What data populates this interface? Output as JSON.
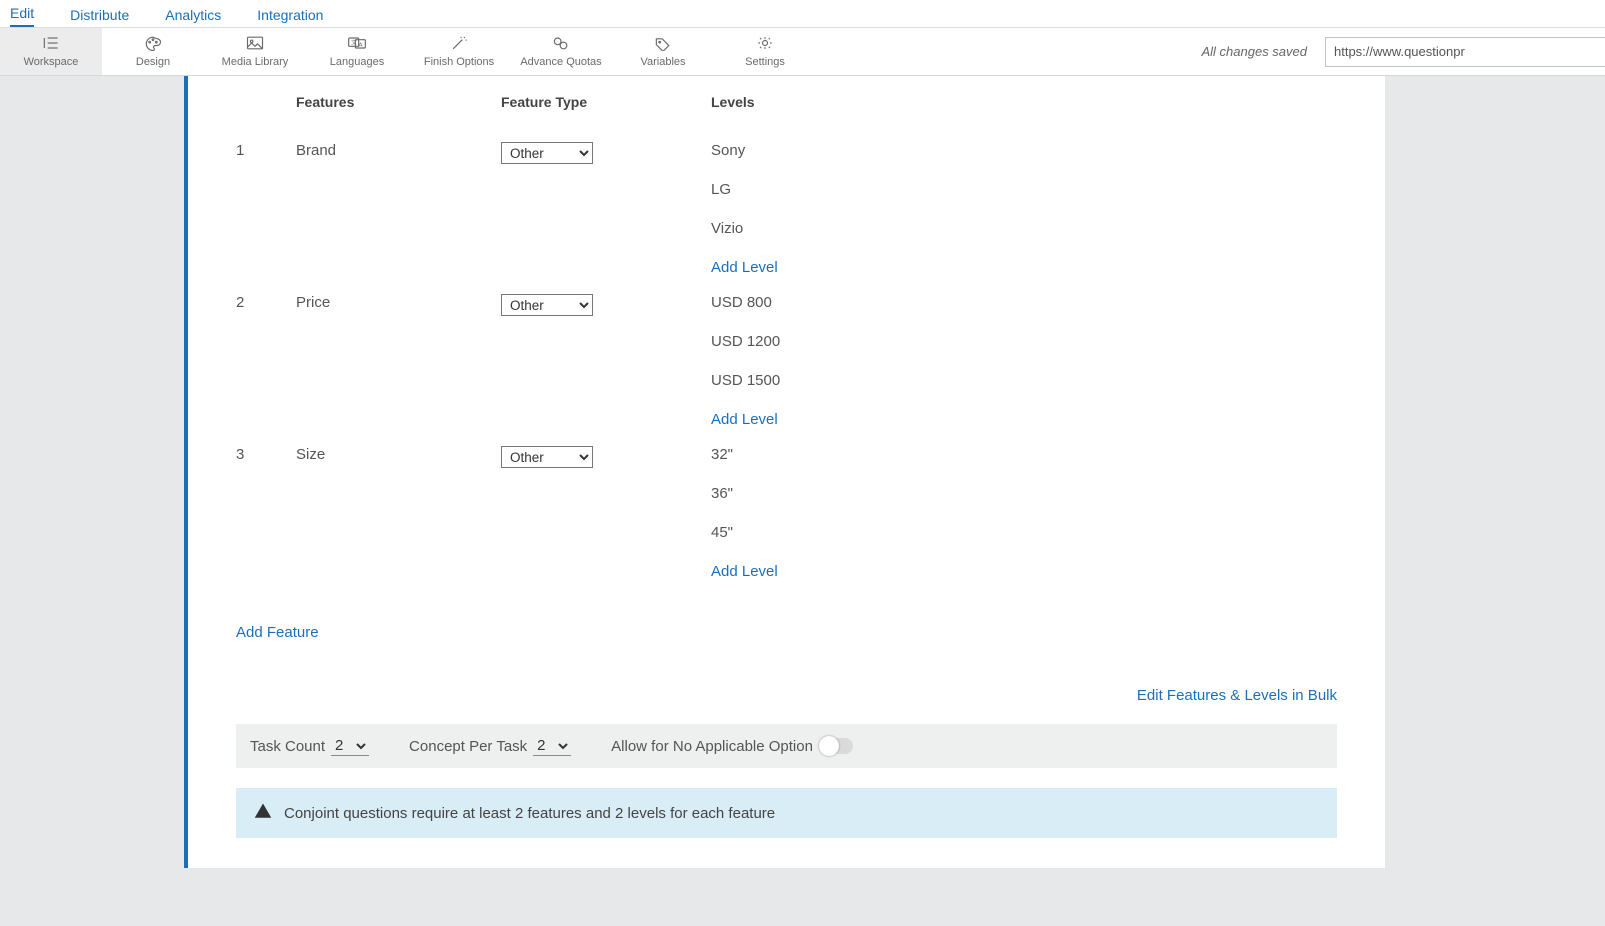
{
  "nav": {
    "tabs": [
      "Edit",
      "Distribute",
      "Analytics",
      "Integration"
    ],
    "active": "Edit"
  },
  "toolbar": {
    "active": "Workspace",
    "buttons": [
      {
        "id": "workspace",
        "label": "Workspace"
      },
      {
        "id": "design",
        "label": "Design"
      },
      {
        "id": "media",
        "label": "Media Library"
      },
      {
        "id": "languages",
        "label": "Languages"
      },
      {
        "id": "finish",
        "label": "Finish Options"
      },
      {
        "id": "quotas",
        "label": "Advance Quotas"
      },
      {
        "id": "variables",
        "label": "Variables"
      },
      {
        "id": "settings",
        "label": "Settings"
      }
    ],
    "saved_msg": "All changes saved",
    "url": "https://www.questionpr"
  },
  "headers": {
    "features": "Features",
    "feature_type": "Feature Type",
    "levels": "Levels"
  },
  "features": [
    {
      "num": "1",
      "name": "Brand",
      "type": "Other",
      "levels": [
        "Sony",
        "LG",
        "Vizio"
      ]
    },
    {
      "num": "2",
      "name": "Price",
      "type": "Other",
      "levels": [
        "USD 800",
        "USD 1200",
        "USD 1500"
      ]
    },
    {
      "num": "3",
      "name": "Size",
      "type": "Other",
      "levels": [
        "32\"",
        "36\"",
        "45\""
      ]
    }
  ],
  "links": {
    "add_level": "Add Level",
    "add_feature": "Add Feature",
    "bulk": "Edit Features & Levels in Bulk"
  },
  "task_bar": {
    "task_count_label": "Task Count",
    "task_count_value": "2",
    "concept_label": "Concept Per Task",
    "concept_value": "2",
    "na_label": "Allow for No Applicable Option"
  },
  "alert": {
    "text": "Conjoint questions require at least 2 features and 2 levels for each feature"
  },
  "select_options": [
    "Other"
  ]
}
